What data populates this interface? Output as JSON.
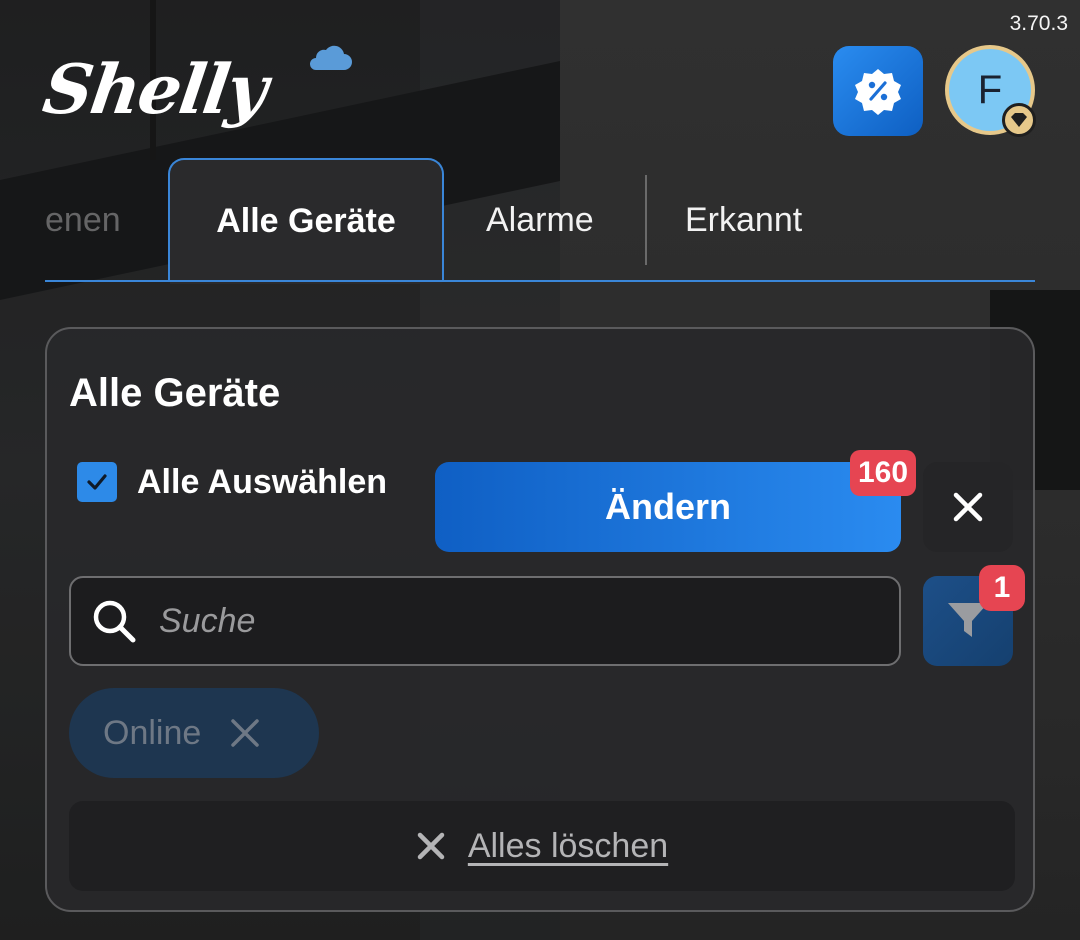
{
  "app": {
    "version": "3.70.3",
    "logo_text": "Shelly"
  },
  "header": {
    "promo_icon": "percent-badge-icon",
    "avatar_letter": "F",
    "avatar_badge_icon": "diamond-icon"
  },
  "tabs": [
    {
      "label": "enen",
      "state": "partially-visible"
    },
    {
      "label": "Alle Geräte",
      "state": "active"
    },
    {
      "label": "Alarme",
      "state": "inactive"
    },
    {
      "label": "Erkannt",
      "state": "inactive"
    }
  ],
  "panel": {
    "title": "Alle Geräte",
    "select_all_label": "Alle Auswählen",
    "select_all_checked": true,
    "change_button_label": "Ändern",
    "selected_count": "160",
    "search_placeholder": "Suche",
    "filter_count": "1",
    "active_filter_chip": "Online",
    "clear_all_label": "Alles löschen"
  },
  "colors": {
    "accent": "#2d8ae8",
    "badge_red": "#e64552",
    "panel_bg": "#28282a"
  }
}
